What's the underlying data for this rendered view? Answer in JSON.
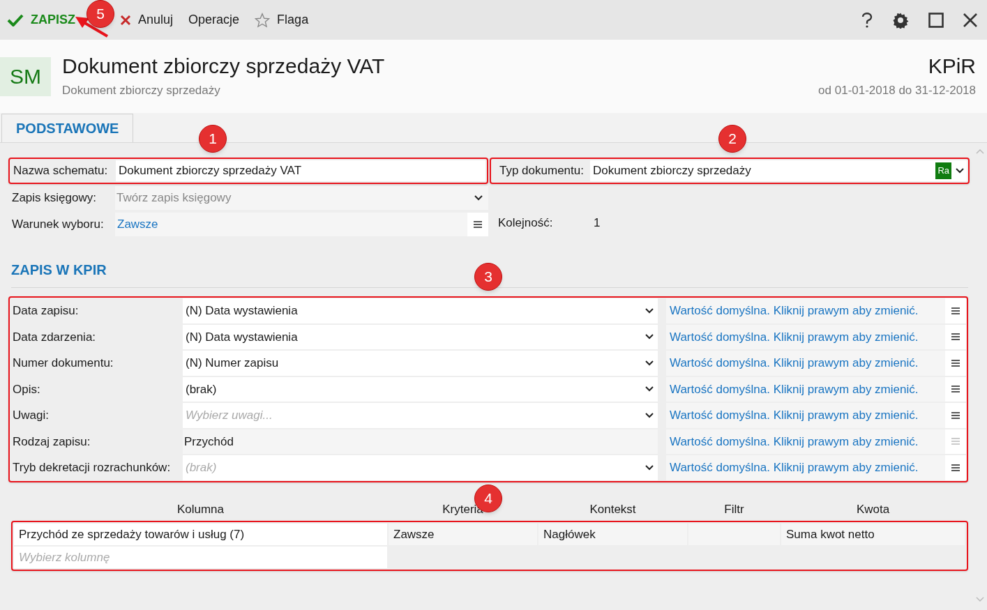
{
  "toolbar": {
    "save": "ZAPISZ",
    "items": [
      {
        "kind": "cancel",
        "label": "Anuluj"
      },
      {
        "kind": "plain",
        "label": "Operacje"
      },
      {
        "kind": "flag",
        "label": "Flaga"
      }
    ]
  },
  "header": {
    "badge": "SM",
    "title": "Dokument zbiorczy sprzedaży VAT",
    "subtitle": "Dokument zbiorczy sprzedaży",
    "context": "KPiR",
    "period": "od 01-01-2018 do 31-12-2018"
  },
  "tabs": [
    {
      "label": "PODSTAWOWE",
      "selected": true
    }
  ],
  "basic": {
    "name_field": {
      "label": "Nazwa schematu:",
      "value": "Dokument zbiorczy sprzedaży VAT"
    },
    "document_type": {
      "label": "Typ dokumentu:",
      "value": "Dokument zbiorczy sprzedaży",
      "tag": "Ra"
    },
    "booking": {
      "label": "Zapis księgowy:",
      "placeholder": "Twórz zapis księgowy"
    },
    "condition": {
      "label": "Warunek wyboru:",
      "value": "Zawsze"
    },
    "order": {
      "label": "Kolejność:",
      "value": "1"
    }
  },
  "section_title": "ZAPIS W KPIR",
  "kpir_rows": [
    {
      "kind": "dropdown",
      "label": "Data zapisu:",
      "value": "(N) Data wystawienia",
      "default_text": "Wartość domyślna. Kliknij prawym aby zmienić.",
      "menu_disabled": false
    },
    {
      "kind": "dropdown",
      "label": "Data zdarzenia:",
      "value": "(N) Data wystawienia",
      "default_text": "Wartość domyślna. Kliknij prawym aby zmienić.",
      "menu_disabled": false
    },
    {
      "kind": "dropdown",
      "label": "Numer dokumentu:",
      "value": "(N) Numer zapisu",
      "default_text": "Wartość domyślna. Kliknij prawym aby zmienić.",
      "menu_disabled": false
    },
    {
      "kind": "dropdown",
      "label": "Opis:",
      "value": "(brak)",
      "default_text": "Wartość domyślna. Kliknij prawym aby zmienić.",
      "menu_disabled": false
    },
    {
      "kind": "dropdown",
      "label": "Uwagi:",
      "placeholder": "Wybierz uwagi...",
      "default_text": "Wartość domyślna. Kliknij prawym aby zmienić.",
      "menu_disabled": false
    },
    {
      "kind": "static",
      "label": "Rodzaj zapisu:",
      "value": "Przychód",
      "default_text": "Wartość domyślna. Kliknij prawym aby zmienić.",
      "menu_disabled": true
    },
    {
      "kind": "dropdown",
      "label": "Tryb dekretacji rozrachunków:",
      "placeholder": "(brak)",
      "default_text": "Wartość domyślna. Kliknij prawym aby zmienić.",
      "menu_disabled": false
    }
  ],
  "table": {
    "columns": [
      "Kolumna",
      "Kryteria",
      "Kontekst",
      "Filtr",
      "Kwota"
    ],
    "rows": [
      {
        "cells": [
          "Przychód ze sprzedaży towarów i usług (7)",
          "Zawsze",
          "Nagłówek",
          null,
          "Suma kwot netto"
        ]
      }
    ],
    "new_row_placeholder": "Wybierz kolumnę"
  },
  "markers": [
    "1",
    "2",
    "3",
    "4",
    "5"
  ]
}
